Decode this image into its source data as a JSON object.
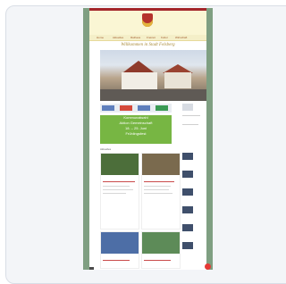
{
  "header": {
    "title": "Willkommen in Stadt Felsberg"
  },
  "nav": {
    "items": [
      "Home",
      "Aktuelles",
      "Rathaus",
      "Freizeit",
      "Kultur",
      "Wirtschaft"
    ]
  },
  "banner": {
    "lines": [
      "Kommunalwahl",
      "Aktion Gemeinschaft",
      "18. – 25. Juni",
      "Frühlingsfest"
    ]
  },
  "section": {
    "label": "Aktuelles"
  }
}
